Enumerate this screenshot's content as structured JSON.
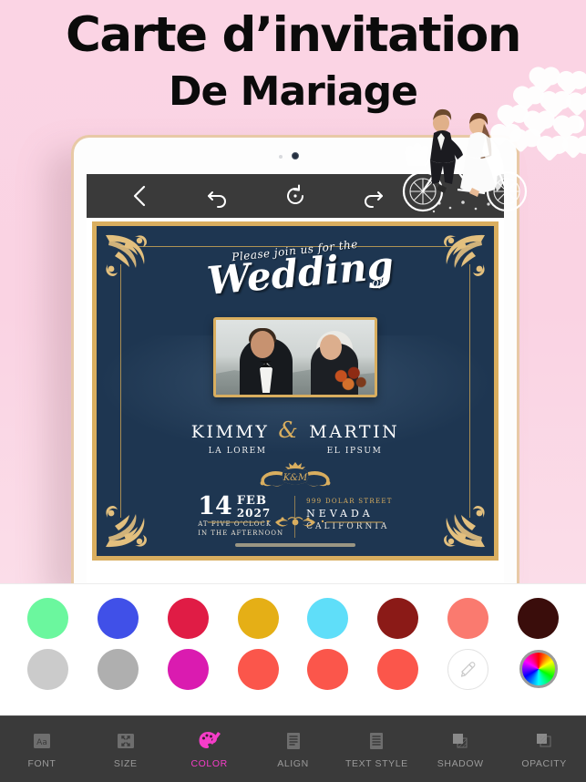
{
  "promo": {
    "title_line1": "Carte d’invitation",
    "title_line2": "De Mariage"
  },
  "app": {
    "toolbar": {
      "back": "back-chevron",
      "undo": "undo-arrow",
      "reset": "reset-circular-arrow",
      "redo": "redo-arrow"
    }
  },
  "card": {
    "join_text": "Please join us for the",
    "wedding_text": "Wedding",
    "of_text": "of",
    "bride_name": "KIMMY",
    "ampersand": "&",
    "groom_name": "MARTIN",
    "bride_sub": "LA LOREM",
    "groom_sub": "EL IPSUM",
    "monogram": "K&M",
    "day": "14",
    "month": "FEB",
    "year": "2027",
    "time_line1": "AT FIVE O’CLOCK",
    "time_line2": "IN THE AFTERNOON",
    "address_line1": "999 DOLAR STREET",
    "address_line2": "NEVADA",
    "address_line3": "CALIFORNIA",
    "colors": {
      "background": "#1e3651",
      "gold": "#d9ae5f"
    }
  },
  "palette": {
    "row1": [
      {
        "name": "mint-green",
        "hex": "#6BF79E"
      },
      {
        "name": "royal-blue",
        "hex": "#4050E8"
      },
      {
        "name": "crimson",
        "hex": "#E01C45"
      },
      {
        "name": "gold",
        "hex": "#E5AF16"
      },
      {
        "name": "cyan",
        "hex": "#5FDEF9"
      },
      {
        "name": "dark-red",
        "hex": "#8B1A17"
      },
      {
        "name": "salmon",
        "hex": "#FA7A6F"
      },
      {
        "name": "dark-brown",
        "hex": "#3A0D0B"
      }
    ],
    "row2": [
      {
        "name": "light-gray",
        "hex": "#CBCBCB"
      },
      {
        "name": "gray",
        "hex": "#AFAFAF"
      },
      {
        "name": "magenta",
        "hex": "#DA1BB0"
      },
      {
        "name": "coral-1",
        "hex": "#FB564B"
      },
      {
        "name": "coral-2",
        "hex": "#FB564B"
      },
      {
        "name": "coral-3",
        "hex": "#FB564B"
      }
    ],
    "eyedropper_icon": "eyedropper-icon",
    "color_wheel_icon": "color-wheel-icon"
  },
  "tabbar": {
    "active": "COLOR",
    "accent": "#f53dc8",
    "items": [
      {
        "label": "FONT",
        "icon": "font-aa-icon"
      },
      {
        "label": "SIZE",
        "icon": "resize-arrows-icon"
      },
      {
        "label": "COLOR",
        "icon": "palette-icon"
      },
      {
        "label": "ALIGN",
        "icon": "align-lines-icon"
      },
      {
        "label": "TEXT STYLE",
        "icon": "text-style-icon"
      },
      {
        "label": "SHADOW",
        "icon": "shadow-squares-icon"
      },
      {
        "label": "OPACITY",
        "icon": "opacity-squares-icon"
      }
    ]
  },
  "decor": {
    "hearts": "floating-hearts",
    "couple": "couple-on-tandem-bicycle"
  }
}
